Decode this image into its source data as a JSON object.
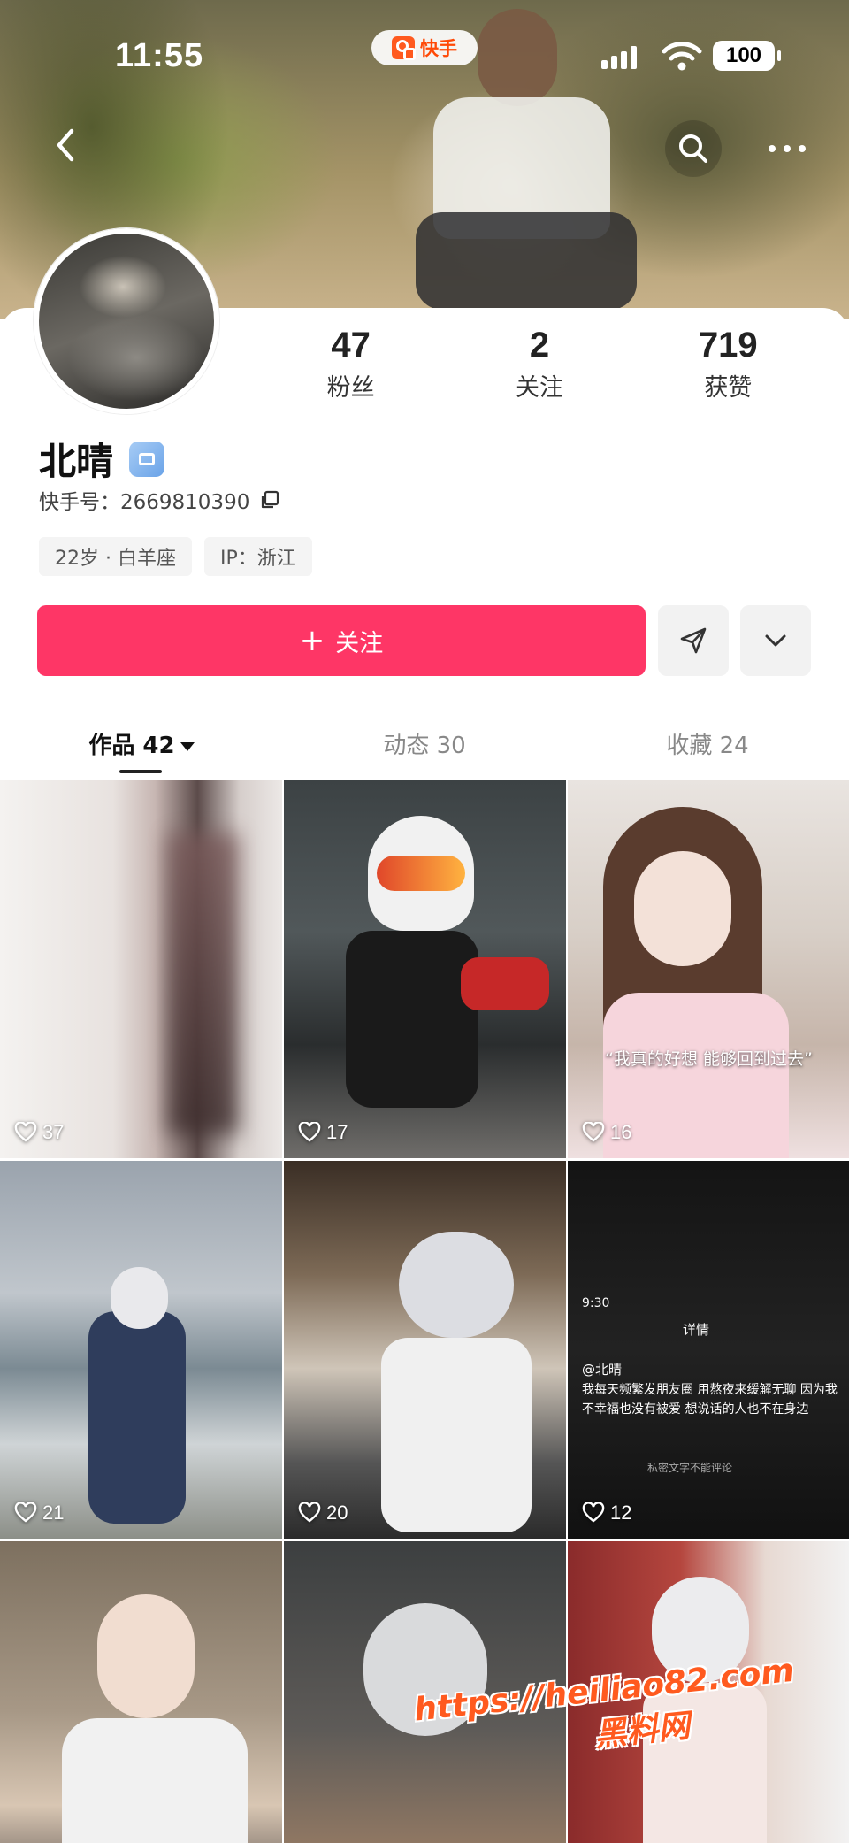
{
  "status_bar": {
    "time": "11:55",
    "app_pill": "快手",
    "battery": "100"
  },
  "profile": {
    "name": "北晴",
    "kuaishou_id": "快手号：2669810390",
    "tags": [
      "22岁 · 白羊座",
      "IP：浙江"
    ],
    "stats": [
      {
        "value": "47",
        "label": "粉丝"
      },
      {
        "value": "2",
        "label": "关注"
      },
      {
        "value": "719",
        "label": "获赞"
      }
    ]
  },
  "actions": {
    "follow_label": "关注",
    "follow_color": "#fe3666"
  },
  "tabs": [
    {
      "label": "作品 42",
      "active": true
    },
    {
      "label": "动态 30",
      "active": false
    },
    {
      "label": "收藏 24",
      "active": false
    }
  ],
  "posts": [
    {
      "likes": "37"
    },
    {
      "likes": "17"
    },
    {
      "likes": "16",
      "caption": "“我真的好想 能够回到过去”"
    },
    {
      "likes": "21"
    },
    {
      "likes": "20"
    },
    {
      "likes": "12",
      "screen_time": "9:30",
      "screen_title": "详情",
      "screen_user": "@北晴",
      "screen_text": "我每天频繁发朋友圈 用熬夜来缓解无聊 因为我不幸福也没有被爱 想说话的人也不在身边",
      "screen_footer": "私密文字不能评论"
    },
    {
      "likes": ""
    },
    {
      "likes": ""
    },
    {
      "likes": ""
    }
  ],
  "watermark": {
    "url": "https://heiliao82.com",
    "text": "黑料网"
  },
  "icons": [
    "back-icon",
    "search-icon",
    "more-icon",
    "verified-badge-icon",
    "copy-icon",
    "plus-icon",
    "share-icon",
    "chevron-down-icon",
    "heart-icon"
  ]
}
